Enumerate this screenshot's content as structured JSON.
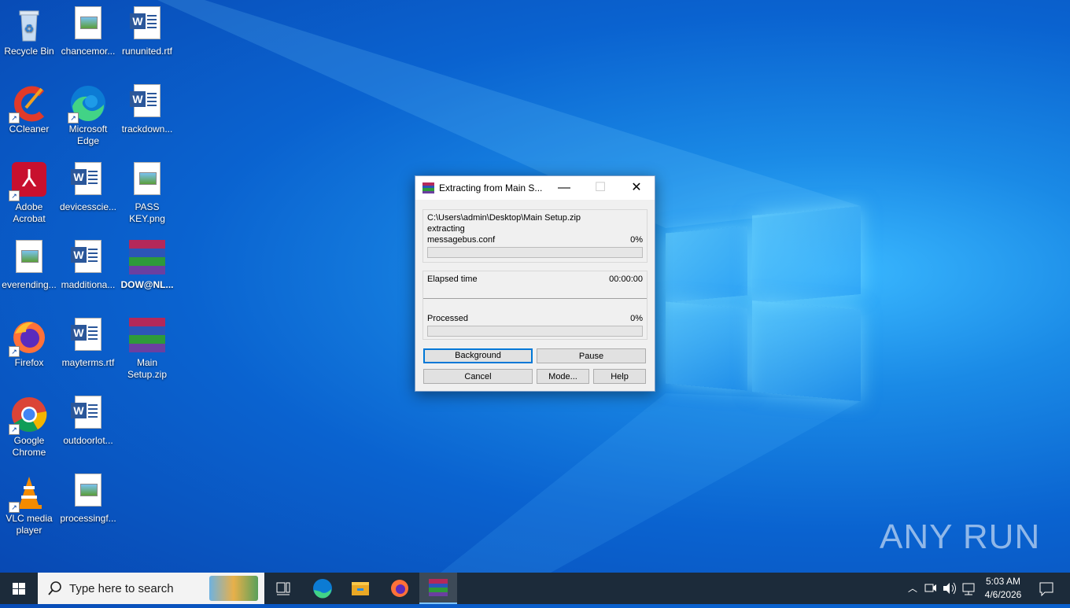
{
  "desktop": {
    "icons": [
      {
        "label": "Recycle Bin"
      },
      {
        "label": "chancemor..."
      },
      {
        "label": "rununited.rtf"
      },
      {
        "label": "CCleaner"
      },
      {
        "label": "Microsoft Edge"
      },
      {
        "label": "trackdown..."
      },
      {
        "label": "Adobe Acrobat"
      },
      {
        "label": "devicesscie..."
      },
      {
        "label": "PASS KEY.png"
      },
      {
        "label": "everending..."
      },
      {
        "label": "madditiona..."
      },
      {
        "label": "DOW@NL..."
      },
      {
        "label": "Firefox"
      },
      {
        "label": "mayterms.rtf"
      },
      {
        "label": "Main Setup.zip"
      },
      {
        "label": "Google Chrome"
      },
      {
        "label": "outdoorlot..."
      },
      {
        "label": "VLC media player"
      },
      {
        "label": "processingf..."
      }
    ]
  },
  "dialog": {
    "title": "Extracting from Main S...",
    "archive_path": "C:\\Users\\admin\\Desktop\\Main Setup.zip",
    "action": "extracting",
    "current_file": "messagebus.conf",
    "file_percent": "0%",
    "file_progress": 0,
    "elapsed_label": "Elapsed time",
    "elapsed_value": "00:00:00",
    "processed_label": "Processed",
    "processed_percent": "0%",
    "processed_progress": 0,
    "buttons": {
      "background": "Background",
      "pause": "Pause",
      "cancel": "Cancel",
      "mode": "Mode...",
      "help": "Help"
    }
  },
  "taskbar": {
    "search_placeholder": "Type here to search",
    "time": "5:03 AM",
    "date": "4/6/2026"
  },
  "watermark": "ANY RUN"
}
